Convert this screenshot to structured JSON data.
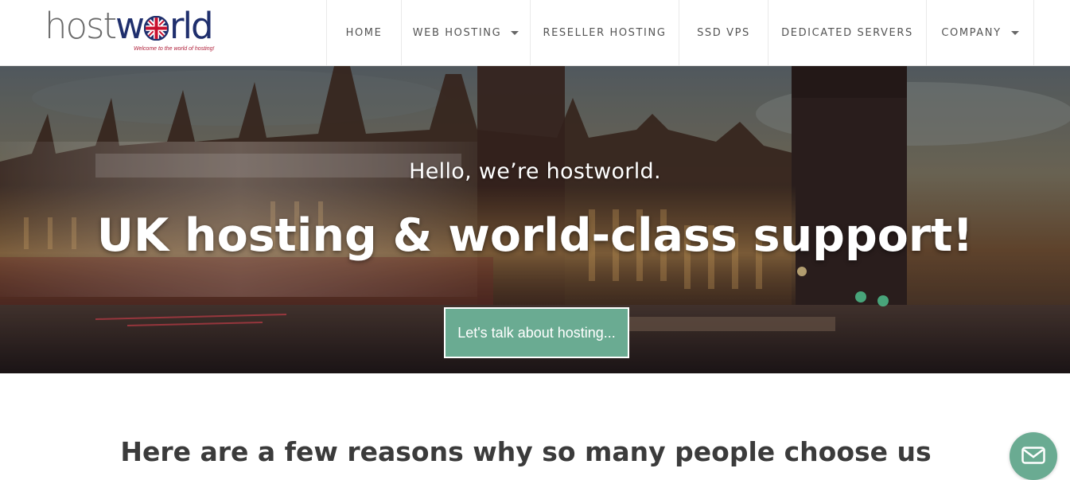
{
  "brand": {
    "logo_host": "host",
    "logo_w": "w",
    "logo_rld": "rld",
    "tagline": "Welcome to the world of hosting!",
    "colors": {
      "navy": "#1f2f6d",
      "red": "#c8102e",
      "grey_text": "#6a6a6a"
    }
  },
  "nav": {
    "items": [
      {
        "label": "HOME",
        "has_dropdown": false
      },
      {
        "label": "WEB HOSTING",
        "has_dropdown": true
      },
      {
        "label": "RESELLER HOSTING",
        "has_dropdown": false
      },
      {
        "label": "SSD VPS",
        "has_dropdown": false
      },
      {
        "label": "DEDICATED SERVERS",
        "has_dropdown": false
      },
      {
        "label": "COMPANY",
        "has_dropdown": true
      }
    ]
  },
  "hero": {
    "subtitle": "Hello, we’re hostworld.",
    "title": "UK hosting & world-class support!",
    "cta_label": "Let's talk about hosting...",
    "accent_color": "#6aab92"
  },
  "reasons": {
    "heading": "Here are a few reasons why so many people choose us"
  },
  "chat": {
    "icon": "envelope-icon"
  }
}
